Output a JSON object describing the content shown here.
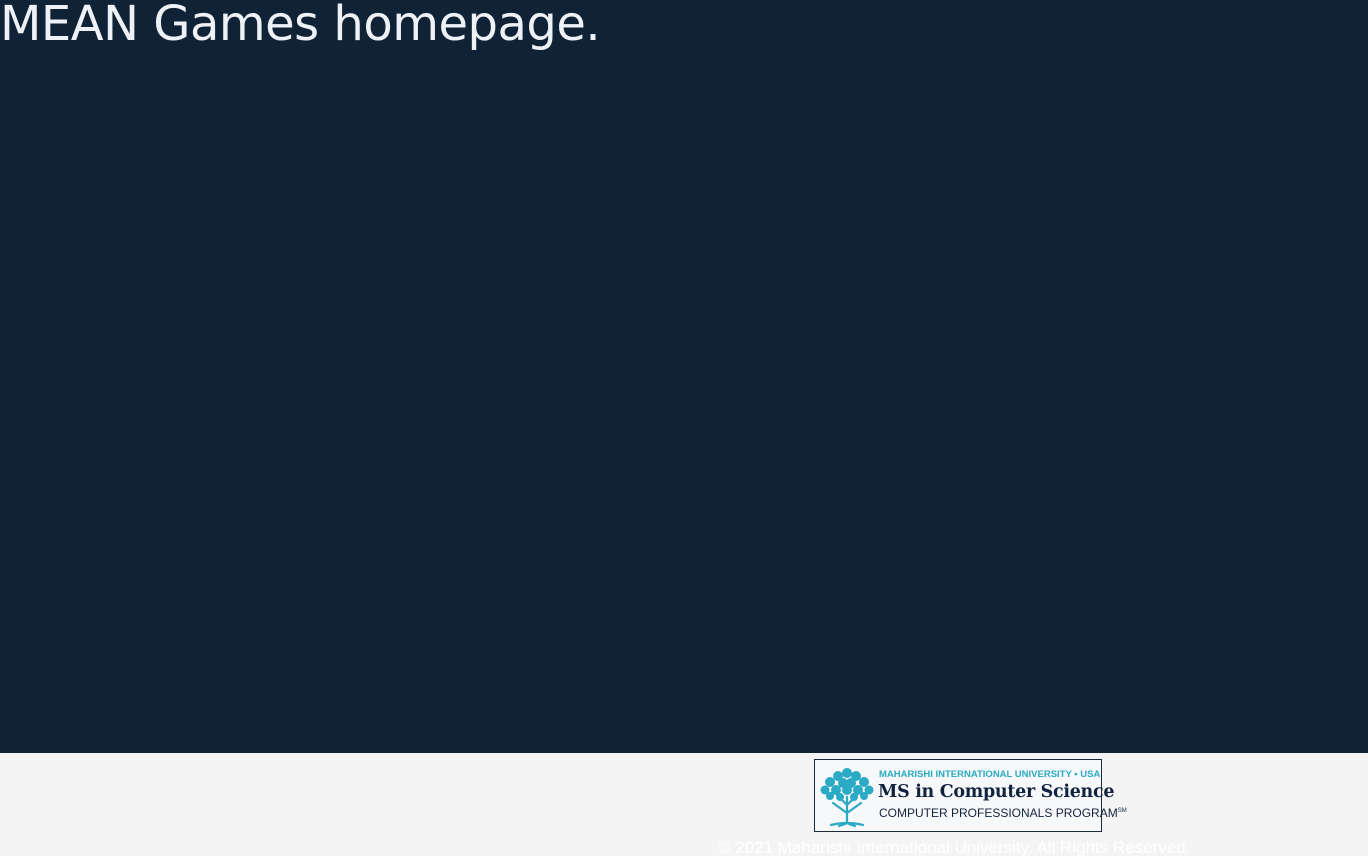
{
  "page": {
    "heading": "MEAN Games homepage."
  },
  "footer": {
    "logo": {
      "icon": "tree-icon",
      "university": "MAHARISHI INTERNATIONAL UNIVERSITY • USA",
      "program": "MS in Computer Science",
      "subprogram": "COMPUTER PROFESSIONALS PROGRAM",
      "mark": "SM"
    },
    "copyright": "© 2021 Maharishi International University. All Rights Reserved."
  },
  "colors": {
    "main_background": "#0f2236",
    "footer_background": "#f4f4f5",
    "heading_text": "#eef2f6",
    "logo_accent": "#2aaac4",
    "logo_dark": "#12233f"
  }
}
